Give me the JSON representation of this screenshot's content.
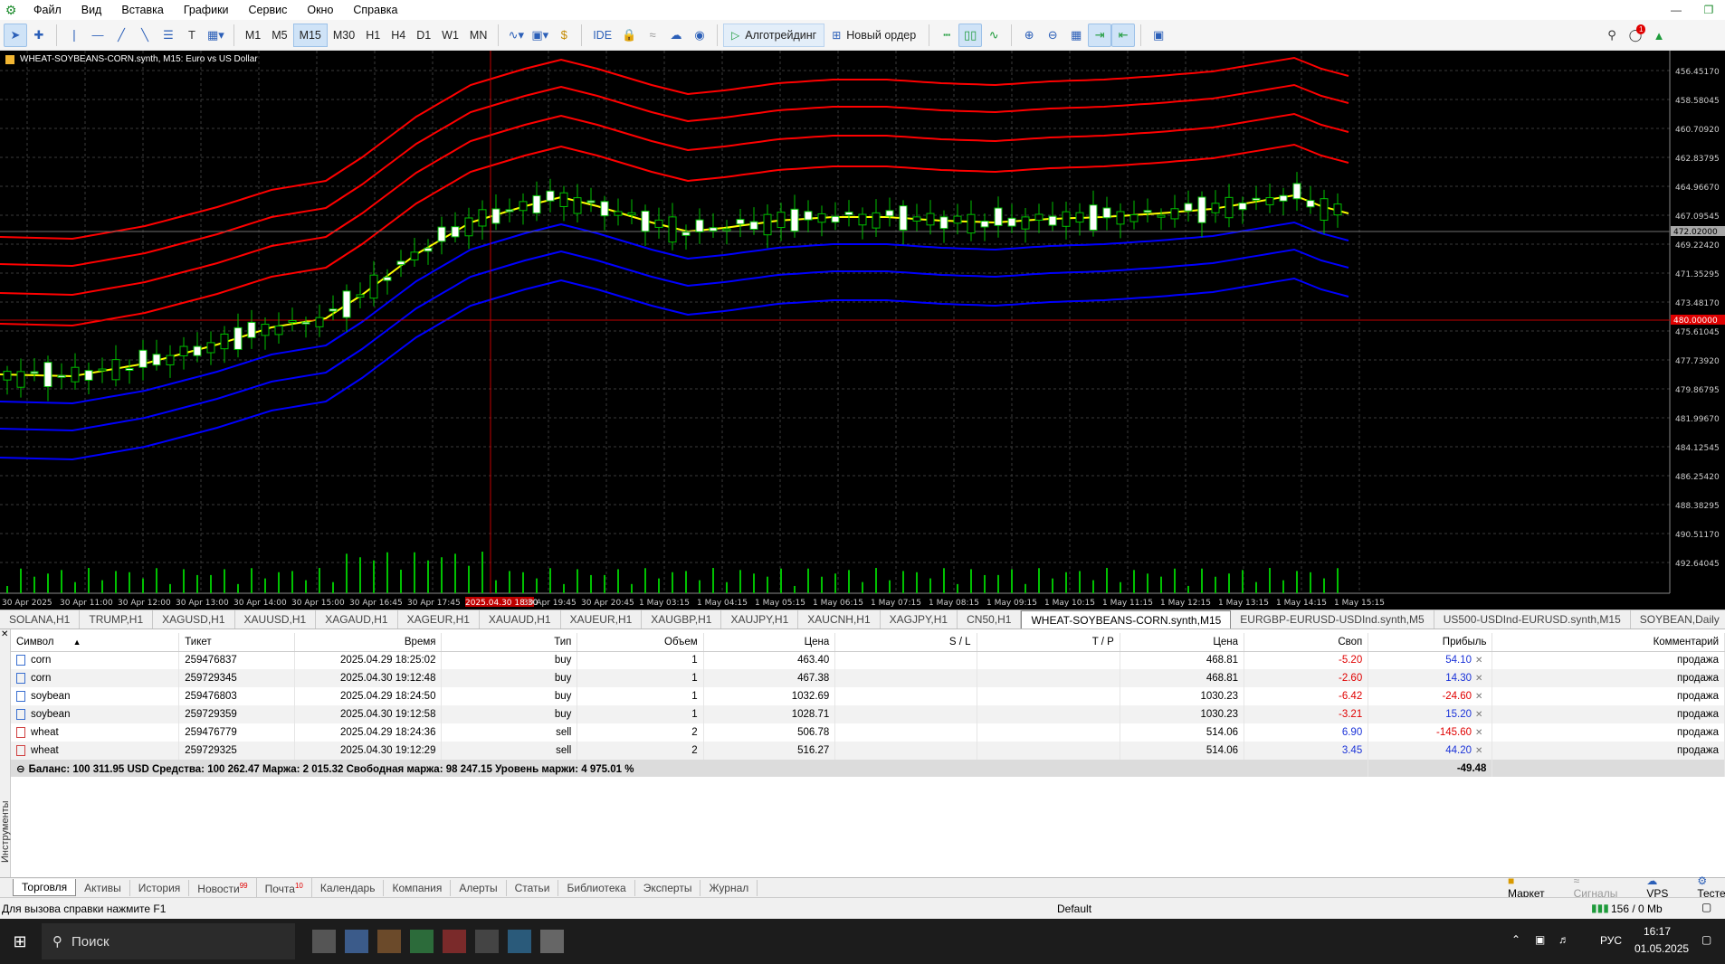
{
  "menu": [
    "Файл",
    "Вид",
    "Вставка",
    "Графики",
    "Сервис",
    "Окно",
    "Справка"
  ],
  "toolbar": {
    "timeframes": [
      "M1",
      "M5",
      "M15",
      "M30",
      "H1",
      "H4",
      "D1",
      "W1",
      "MN"
    ],
    "active_timeframe": "M15",
    "ide_label": "IDE",
    "algo_label": "Алготрейдинг",
    "new_order_label": "Новый ордер",
    "notification_count": "1"
  },
  "chart": {
    "title": "WHEAT-SOYBEANS-CORN.synth, M15:  Euro vs US Dollar",
    "price_labels": [
      "456.45170",
      "458.58045",
      "460.70920",
      "462.83795",
      "464.96670",
      "467.09545",
      "469.22420",
      "471.35295",
      "473.48170",
      "475.61045",
      "477.73920",
      "479.86795",
      "481.99670",
      "484.12545",
      "486.25420",
      "488.38295",
      "490.51170",
      "492.64045"
    ],
    "current_price_tag": "472.02000",
    "red_line_tag": "480.00000",
    "time_labels": [
      "30 Apr 2025",
      "30 Apr 11:00",
      "30 Apr 12:00",
      "30 Apr 13:00",
      "30 Apr 14:00",
      "30 Apr 15:00",
      "30 Apr 16:45",
      "30 Apr 17:45",
      "2025.04.30 18:30",
      "30 Apr 19:45",
      "30 Apr 20:45",
      "1 May 03:15",
      "1 May 04:15",
      "1 May 05:15",
      "1 May 06:15",
      "1 May 07:15",
      "1 May 08:15",
      "1 May 09:15",
      "1 May 10:15",
      "1 May 11:15",
      "1 May 12:15",
      "1 May 13:15",
      "1 May 14:15",
      "1 May 15:15"
    ]
  },
  "chart_tabs": [
    "SOLANA,H1",
    "TRUMP,H1",
    "XAGUSD,H1",
    "XAUUSD,H1",
    "XAGAUD,H1",
    "XAGEUR,H1",
    "XAUAUD,H1",
    "XAUEUR,H1",
    "XAUGBP,H1",
    "XAUJPY,H1",
    "XAUCNH,H1",
    "XAGJPY,H1",
    "CN50,H1",
    "WHEAT-SOYBEANS-CORN.synth,M15",
    "EURGBP-EURUSD-USDInd.synth,M5",
    "US500-USDInd-EURUSD.synth,M15",
    "SOYBEAN,Daily"
  ],
  "active_chart_tab": "WHEAT-SOYBEANS-CORN.synth,M15",
  "trades": {
    "headers": {
      "symbol": "Символ",
      "ticket": "Тикет",
      "time": "Время",
      "type": "Тип",
      "volume": "Объем",
      "price": "Цена",
      "sl": "S / L",
      "tp": "T / P",
      "cur_price": "Цена",
      "swap": "Своп",
      "profit": "Прибыль",
      "comment": "Комментарий"
    },
    "rows": [
      {
        "symbol": "corn",
        "ticket": "259476837",
        "time": "2025.04.29 18:25:02",
        "type": "buy",
        "volume": "1",
        "price": "463.40",
        "cur_price": "468.81",
        "swap": "-5.20",
        "profit": "54.10",
        "comment": "продажа"
      },
      {
        "symbol": "corn",
        "ticket": "259729345",
        "time": "2025.04.30 19:12:48",
        "type": "buy",
        "volume": "1",
        "price": "467.38",
        "cur_price": "468.81",
        "swap": "-2.60",
        "profit": "14.30",
        "comment": "продажа"
      },
      {
        "symbol": "soybean",
        "ticket": "259476803",
        "time": "2025.04.29 18:24:50",
        "type": "buy",
        "volume": "1",
        "price": "1032.69",
        "cur_price": "1030.23",
        "swap": "-6.42",
        "profit": "-24.60",
        "comment": "продажа"
      },
      {
        "symbol": "soybean",
        "ticket": "259729359",
        "time": "2025.04.30 19:12:58",
        "type": "buy",
        "volume": "1",
        "price": "1028.71",
        "cur_price": "1030.23",
        "swap": "-3.21",
        "profit": "15.20",
        "comment": "продажа"
      },
      {
        "symbol": "wheat",
        "ticket": "259476779",
        "time": "2025.04.29 18:24:36",
        "type": "sell",
        "volume": "2",
        "price": "506.78",
        "cur_price": "514.06",
        "swap": "6.90",
        "profit": "-145.60",
        "comment": "продажа"
      },
      {
        "symbol": "wheat",
        "ticket": "259729325",
        "time": "2025.04.30 19:12:29",
        "type": "sell",
        "volume": "2",
        "price": "516.27",
        "cur_price": "514.06",
        "swap": "3.45",
        "profit": "44.20",
        "comment": "продажа"
      }
    ],
    "summary": "Баланс: 100 311.95 USD  Средства: 100 262.47  Маржа: 2 015.32  Свободная маржа: 98 247.15  Уровень маржи: 4 975.01 %",
    "summary_total": "-49.48"
  },
  "side_label": "Инструменты",
  "bottom_tabs": [
    {
      "label": "Торговля",
      "badge": ""
    },
    {
      "label": "Активы",
      "badge": ""
    },
    {
      "label": "История",
      "badge": ""
    },
    {
      "label": "Новости",
      "badge": "99"
    },
    {
      "label": "Почта",
      "badge": "10"
    },
    {
      "label": "Календарь",
      "badge": ""
    },
    {
      "label": "Компания",
      "badge": ""
    },
    {
      "label": "Алерты",
      "badge": ""
    },
    {
      "label": "Статьи",
      "badge": ""
    },
    {
      "label": "Библиотека",
      "badge": ""
    },
    {
      "label": "Эксперты",
      "badge": ""
    },
    {
      "label": "Журнал",
      "badge": ""
    }
  ],
  "bottom_right": {
    "market": "Маркет",
    "signals": "Сигналы",
    "vps": "VPS",
    "tester": "Тестер"
  },
  "status": {
    "help": "Для вызова справки нажмите F1",
    "profile": "Default",
    "traffic": "156 / 0 Mb"
  },
  "taskbar": {
    "search": "Поиск",
    "lang": "РУС",
    "time": "16:17",
    "date": "01.05.2025"
  },
  "colors": {
    "bull": "#ffffff",
    "bear": "#ffffff",
    "candle_green": "#00c000",
    "band_red": "#ff0000",
    "band_blue": "#0000ff",
    "center_yellow": "#ffff00",
    "volume": "#00c000"
  }
}
